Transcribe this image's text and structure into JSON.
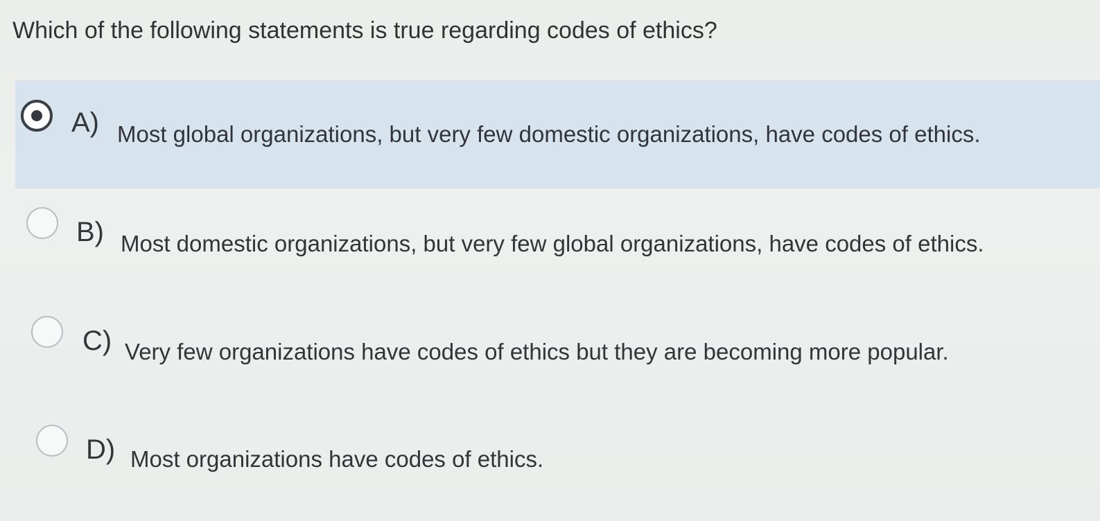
{
  "question": {
    "text": "Which of the following statements is true regarding codes of ethics?"
  },
  "options": [
    {
      "letter": "A)",
      "text": "Most global organizations, but very few domestic organizations, have codes of ethics.",
      "selected": true
    },
    {
      "letter": "B)",
      "text": "Most domestic organizations, but very few global organizations, have codes of ethics.",
      "selected": false
    },
    {
      "letter": "C)",
      "text": "Very few organizations have codes of ethics but they are becoming more popular.",
      "selected": false
    },
    {
      "letter": "D)",
      "text": "Most organizations have codes of ethics.",
      "selected": false
    }
  ],
  "colors": {
    "selected_background": "#d7e4ee",
    "page_background": "#eceeec",
    "text": "#323437"
  }
}
